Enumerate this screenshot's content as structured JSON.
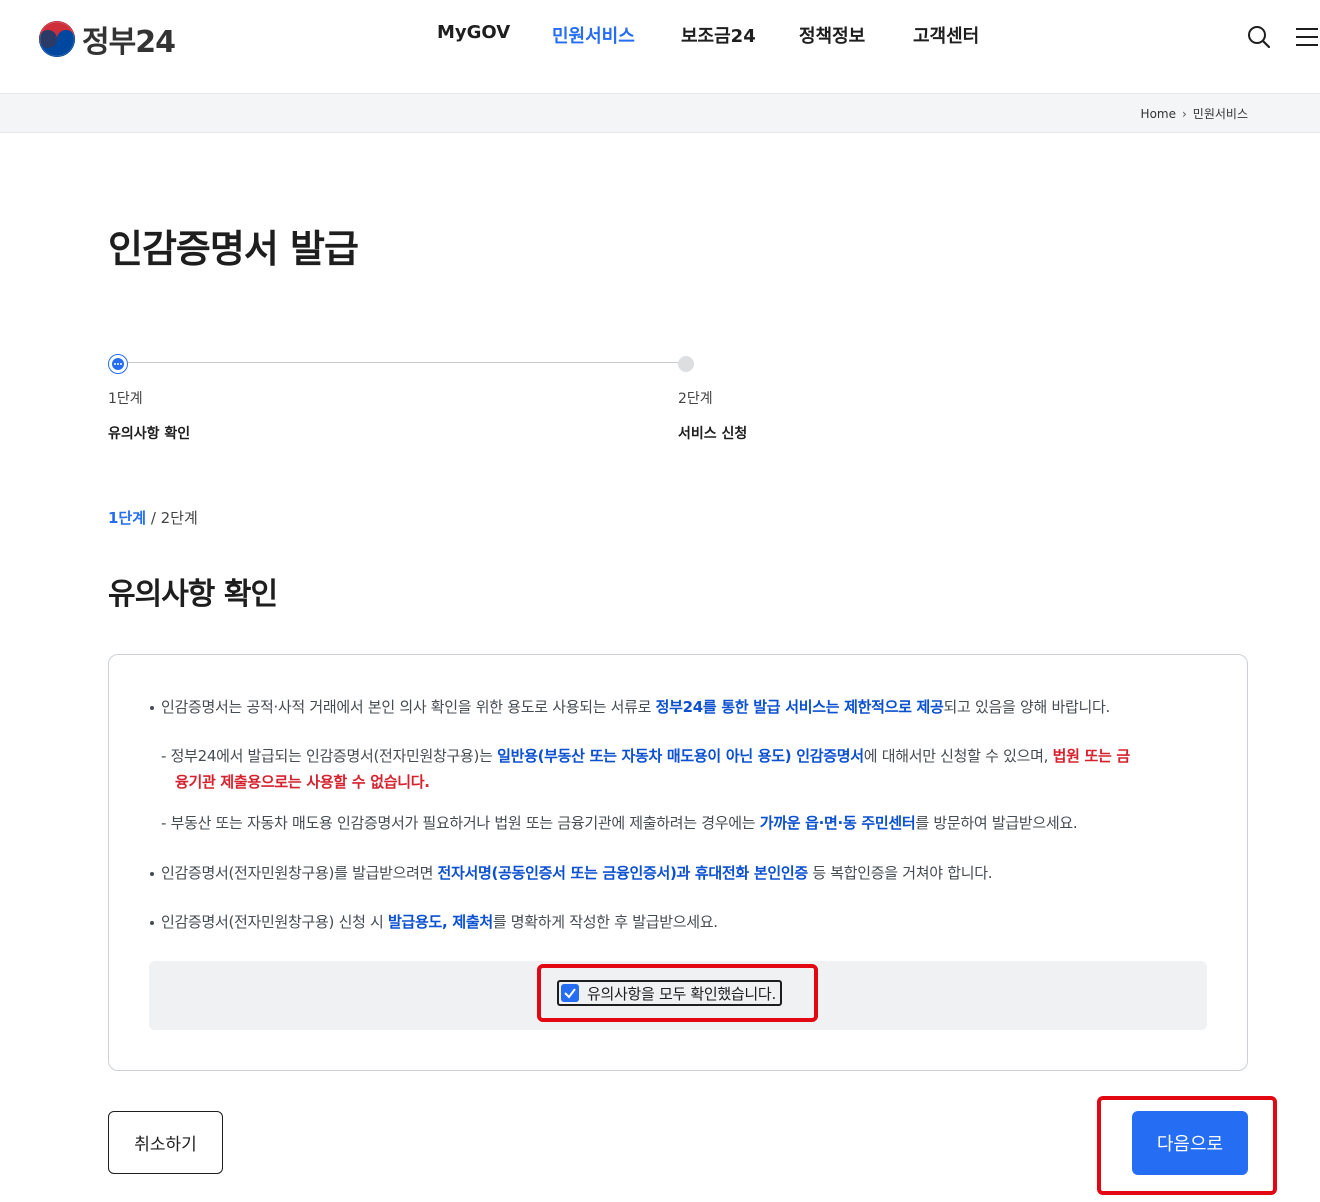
{
  "brand": {
    "name": "정부24"
  },
  "gnb": [
    {
      "label": "MyGOV",
      "active": false
    },
    {
      "label": "민원서비스",
      "active": true
    },
    {
      "label": "보조금24",
      "active": false
    },
    {
      "label": "정책정보",
      "active": false
    },
    {
      "label": "고객센터",
      "active": false
    }
  ],
  "header_icons": [
    "search-icon",
    "menu-icon"
  ],
  "breadcrumb": {
    "home": "Home",
    "current": "민원서비스"
  },
  "page": {
    "title": "인감증명서 발급"
  },
  "stepper": {
    "steps": [
      {
        "num": "1단계",
        "name": "유의사항 확인",
        "status": "current"
      },
      {
        "num": "2단계",
        "name": "서비스 신청",
        "status": "pending"
      }
    ]
  },
  "step_indicator": {
    "current": "1단계",
    "sep": " / ",
    "total": "2단계"
  },
  "section": {
    "title": "유의사항 확인"
  },
  "notices": {
    "n1": {
      "t1": "인감증명서는 공적·사적 거래에서 본인 의사 확인을 위한 용도로 사용되는 서류로 ",
      "b1": "정부24를 통한 발급 서비스는 제한적으로 제공",
      "t2": "되고 있음을 양해 바랍니다."
    },
    "n2": {
      "t1": "- 정부24에서 발급되는 인감증명서(전자민원창구용)는 ",
      "b1": "일반용(부동산 또는 자동차 매도용이 아닌 용도) 인감증명서",
      "t2": "에 대해서만 신청할 수 있으며, ",
      "r1": "법원 또는 금",
      "r2": "융기관 제출용으로는 사용할 수 없습니다."
    },
    "n3": {
      "t1": "- 부동산 또는 자동차 매도용 인감증명서가 필요하거나 법원 또는 금융기관에 제출하려는 경우에는 ",
      "b1": "가까운 읍·면·동 주민센터",
      "t2": "를 방문하여 발급받으세요."
    },
    "n4": {
      "t1": "인감증명서(전자민원창구용)를 발급받으려면 ",
      "b1": "전자서명(공동인증서 또는 금융인증서)과 휴대전화 본인인증",
      "t2": " 등 복합인증을 거쳐야 합니다."
    },
    "n5": {
      "t1": "인감증명서(전자민원창구용) 신청 시 ",
      "b1": "발급용도, 제출처",
      "t2": "를 명확하게 작성한 후 발급받으세요."
    }
  },
  "confirm": {
    "label": "유의사항을 모두 확인했습니다.",
    "checked": true
  },
  "buttons": {
    "cancel": "취소하기",
    "next": "다음으로"
  },
  "colors": {
    "accent": "#256ef4",
    "emphasis_blue": "#0b50d0",
    "emphasis_red": "#d5222e",
    "annotation_red": "#e30613"
  }
}
